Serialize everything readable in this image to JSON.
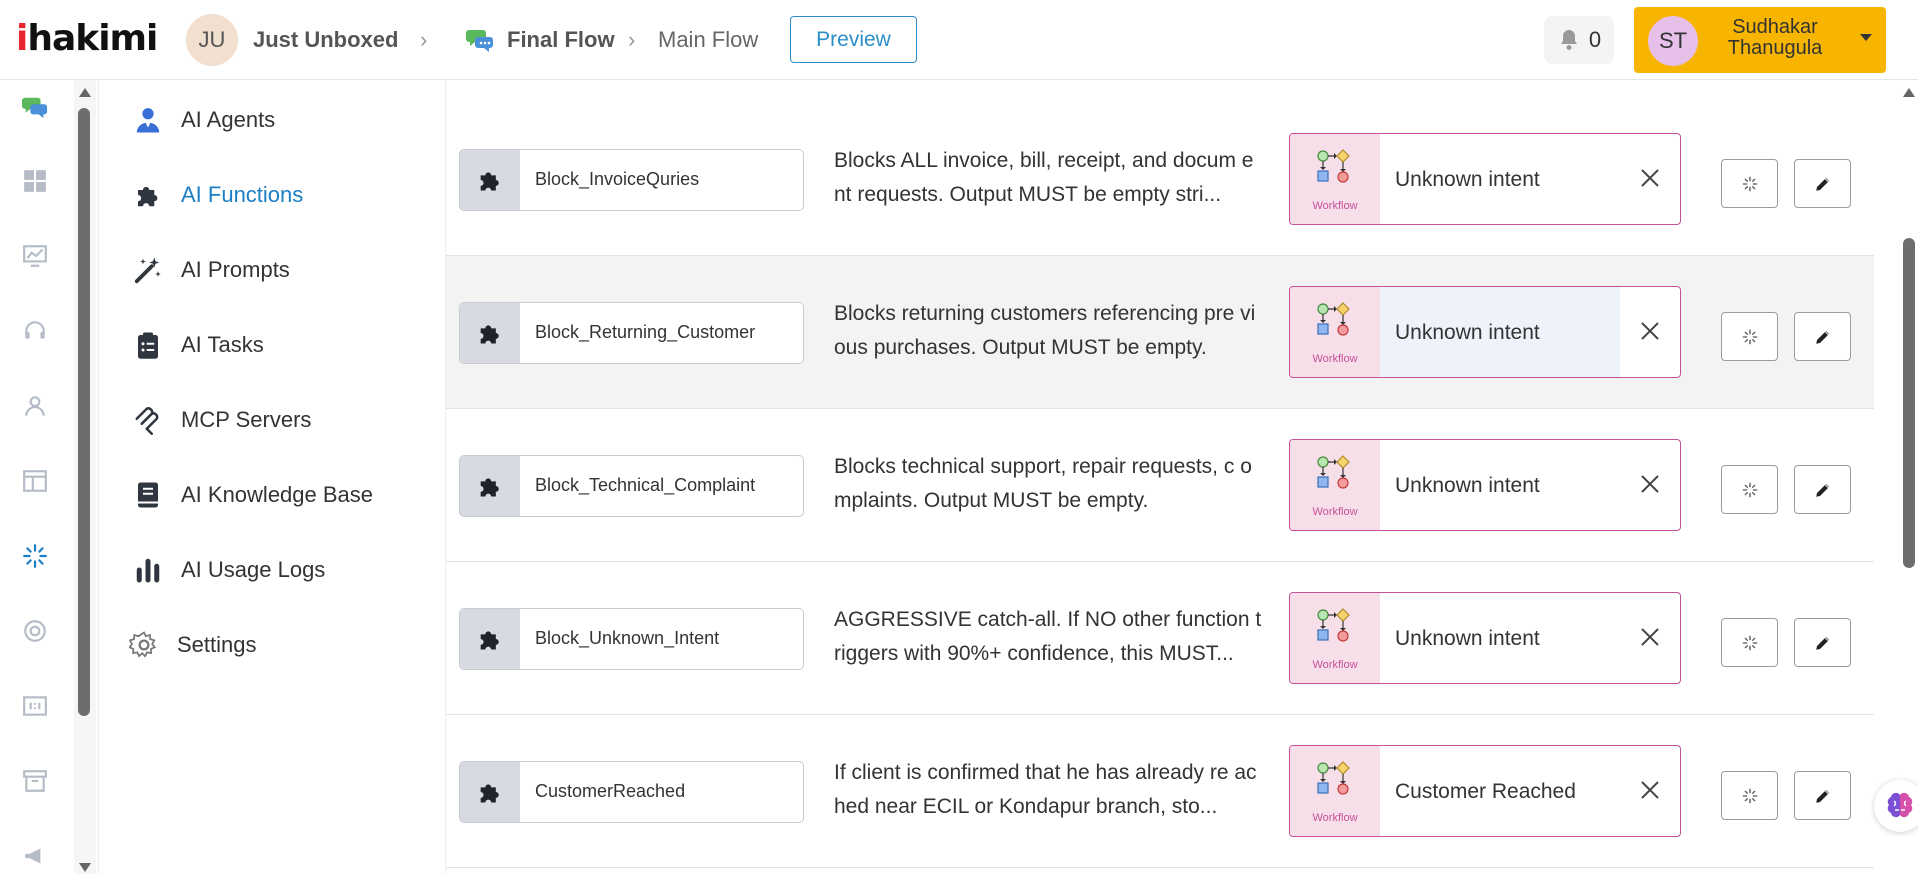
{
  "header": {
    "logo": "ihakimi",
    "project_initials": "JU",
    "project_name": "Just Unboxed",
    "flow_name": "Final Flow",
    "sub_flow": "Main Flow",
    "preview_label": "Preview",
    "notification_count": "0",
    "user_initials": "ST",
    "user_name": "Sudhakar Thanugula",
    "brand_color": "#f7b500"
  },
  "rail_icons": [
    "chat-logo-icon",
    "dashboard-icon",
    "analytics-icon",
    "headset-icon",
    "user-icon",
    "layout-icon",
    "ai-spark-icon",
    "support-icon",
    "ratio-icon",
    "archive-icon",
    "megaphone-icon"
  ],
  "menu": {
    "items": [
      {
        "label": "AI Agents",
        "icon": "ai-agent-icon",
        "active": false
      },
      {
        "label": "AI Functions",
        "icon": "puzzle-icon",
        "active": true
      },
      {
        "label": "AI Prompts",
        "icon": "magic-wand-icon",
        "active": false
      },
      {
        "label": "AI Tasks",
        "icon": "clipboard-icon",
        "active": false
      },
      {
        "label": "MCP Servers",
        "icon": "mcp-icon",
        "active": false
      },
      {
        "label": "AI Knowledge Base",
        "icon": "book-icon",
        "active": false
      },
      {
        "label": "AI Usage Logs",
        "icon": "bar-chart-icon",
        "active": false
      },
      {
        "label": "Settings",
        "icon": "gear-icon",
        "active": false
      }
    ],
    "active_color": "#1b7fc4"
  },
  "functions": [
    {
      "name": "Block_InvoiceQuries",
      "description": "Blocks ALL invoice, bill, receipt, and docum ent requests. Output MUST be empty stri...",
      "workflow_label": "Workflow",
      "intent": "Unknown intent"
    },
    {
      "name": "Block_Returning_Customer",
      "description": "Blocks returning customers referencing pre vious purchases. Output MUST be empty.",
      "workflow_label": "Workflow",
      "intent": "Unknown intent"
    },
    {
      "name": "Block_Technical_Complaint",
      "description": "Blocks technical support, repair requests, c omplaints. Output MUST be empty.",
      "workflow_label": "Workflow",
      "intent": "Unknown intent"
    },
    {
      "name": "Block_Unknown_Intent",
      "description": "AGGRESSIVE catch-all. If NO other function triggers with 90%+ confidence, this MUST...",
      "workflow_label": "Workflow",
      "intent": "Unknown intent"
    },
    {
      "name": "CustomerReached",
      "description": "If client is confirmed that he has already re ached near ECIL or Kondapur branch, sto...",
      "workflow_label": "Workflow",
      "intent": "Customer Reached"
    }
  ],
  "intent_border_color": "#c7509b"
}
